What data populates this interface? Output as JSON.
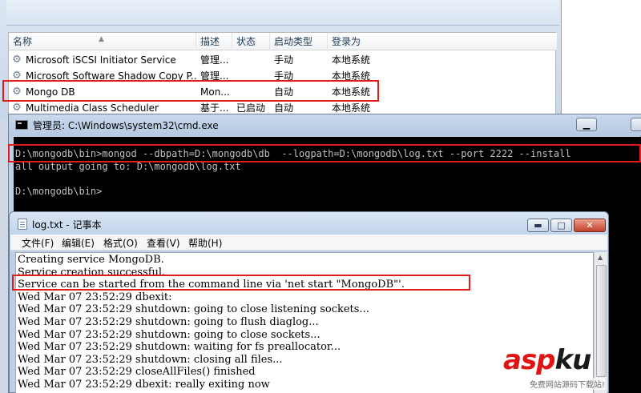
{
  "services": {
    "columns": [
      "名称",
      "描述",
      "状态",
      "启动类型",
      "登录为"
    ],
    "rows": [
      {
        "name": "Microsoft iSCSI Initiator Service",
        "desc": "管理...",
        "status": "",
        "startup": "手动",
        "logon": "本地系统"
      },
      {
        "name": "Microsoft Software Shadow Copy P...",
        "desc": "管理...",
        "status": "",
        "startup": "手动",
        "logon": "本地系统"
      },
      {
        "name": "Mongo DB",
        "desc": "Mon...",
        "status": "",
        "startup": "自动",
        "logon": "本地系统"
      },
      {
        "name": "Multimedia Class Scheduler",
        "desc": "基于...",
        "status": "已启动",
        "startup": "自动",
        "logon": "本地系统"
      }
    ]
  },
  "cmd": {
    "title": "管理员: C:\\Windows\\system32\\cmd.exe",
    "lines": [
      "D:\\mongodb\\bin>mongod --dbpath=D:\\mongodb\\db  --logpath=D:\\mongodb\\log.txt --port 2222 --install",
      "all output going to: D:\\mongodb\\log.txt",
      "",
      "D:\\mongodb\\bin>"
    ]
  },
  "notepad": {
    "title": "log.txt - 记事本",
    "menu": [
      "文件(F)",
      "编辑(E)",
      "格式(O)",
      "查看(V)",
      "帮助(H)"
    ],
    "lines": [
      "Creating service MongoDB.",
      "Service creation successful.",
      "Service can be started from the command line via 'net start \"MongoDB\"'.",
      "Wed Mar 07 23:52:29 dbexit:",
      "Wed Mar 07 23:52:29 shutdown: going to close listening sockets...",
      "Wed Mar 07 23:52:29 shutdown: going to flush diaglog...",
      "Wed Mar 07 23:52:29 shutdown: going to close sockets...",
      "Wed Mar 07 23:52:29 shutdown: waiting for fs preallocator...",
      "Wed Mar 07 23:52:29 shutdown: closing all files...",
      "Wed Mar 07 23:52:29 closeAllFiles() finished",
      "Wed Mar 07 23:52:29 dbexit: really exiting now"
    ]
  },
  "watermark": {
    "logo_part1": "asp",
    "logo_part2": "ku",
    "sub": "免费网站源码下载站!"
  },
  "colors": {
    "highlight": "#e41b1b",
    "console_bg": "#000000",
    "console_fg": "#c0c0c0"
  }
}
